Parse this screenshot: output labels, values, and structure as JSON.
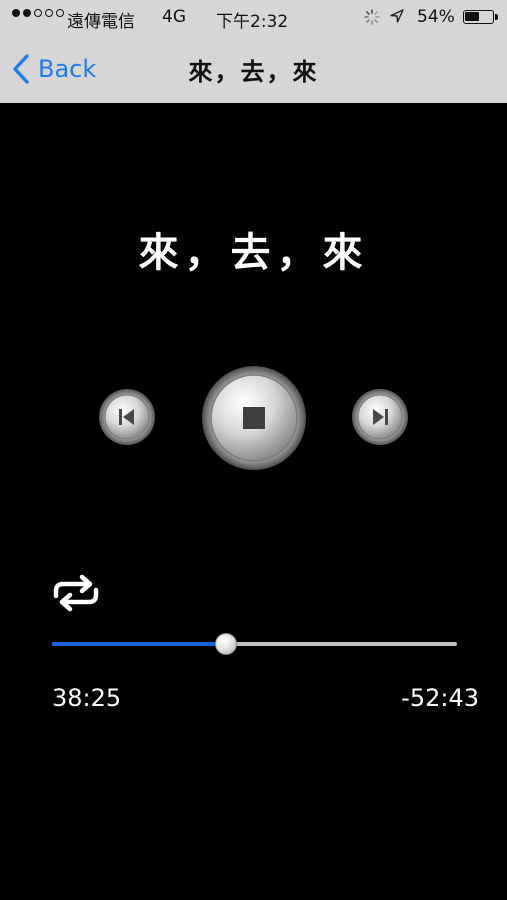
{
  "status_bar": {
    "signal_dots_filled": 2,
    "signal_dots_total": 5,
    "carrier": "遠傳電信",
    "network": "4G",
    "time": "下午2:32",
    "battery_percent_text": "54%",
    "battery_level": 0.54
  },
  "nav": {
    "back_label": "Back",
    "title": "來，去，來"
  },
  "player": {
    "track_title": "來，去，來",
    "progress_fraction": 0.42,
    "elapsed": "38:25",
    "remaining": "-52:43"
  },
  "colors": {
    "accent": "#1e7cf2",
    "progress_fill": "#1a63d8",
    "nav_bg": "#d6d6d6",
    "background": "#000000"
  },
  "icons": {
    "back": "chevron-left-icon",
    "prev": "skip-previous-icon",
    "stop": "stop-icon",
    "next": "skip-next-icon",
    "repeat": "repeat-icon"
  }
}
